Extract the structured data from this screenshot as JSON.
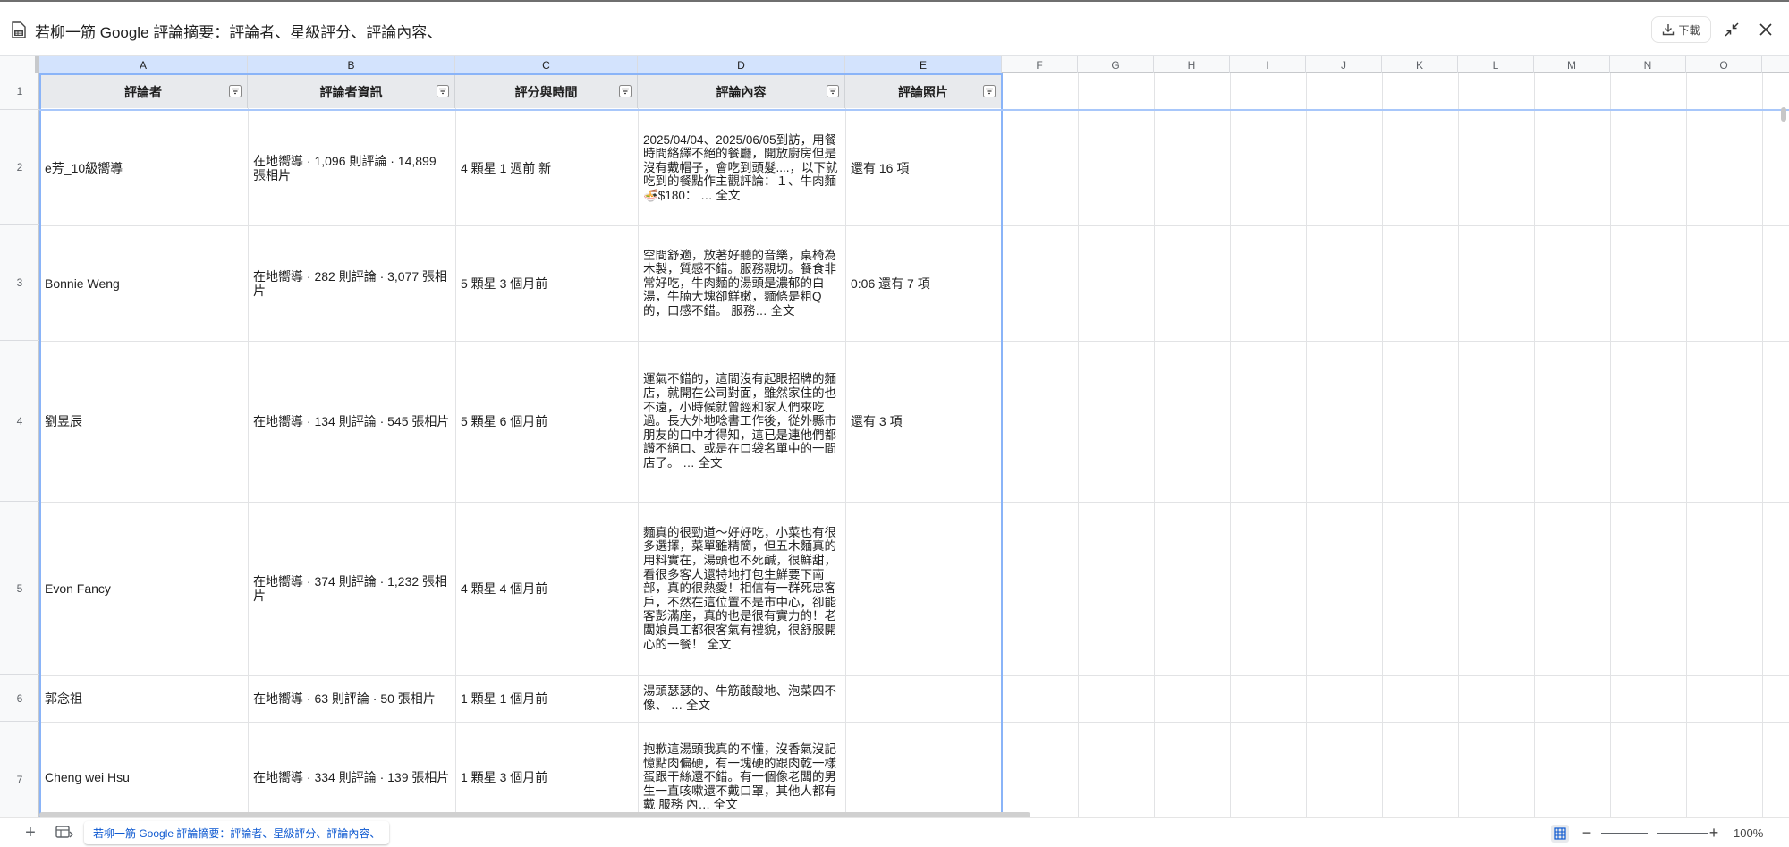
{
  "window": {
    "title": "若柳一筋 Google 評論摘要：評論者、星級評分、評論內容、",
    "download_label": "下載"
  },
  "columns": [
    "A",
    "B",
    "C",
    "D",
    "E",
    "F",
    "G",
    "H",
    "I",
    "J",
    "K",
    "L",
    "M",
    "N",
    "O"
  ],
  "selected_columns": [
    "A",
    "B",
    "C",
    "D",
    "E"
  ],
  "header_row": {
    "row_number": "1",
    "cells": [
      "評論者",
      "評論者資訊",
      "評分與時間",
      "評論內容",
      "評論照片"
    ]
  },
  "rows": [
    {
      "row_number": "2",
      "reviewer": "e芳_10級嚮導",
      "info": "在地嚮導 · 1,096 則評論 · 14,899 張相片",
      "rating": "4 顆星 1 週前 新",
      "content": "2025/04/04、2025/06/05到訪，用餐時間絡繹不絕的餐廳，開放廚房但是沒有戴帽子，會吃到頭髮....，以下就吃到的餐點作主觀評論：１、牛肉麵🍜$180： … 全文",
      "photos": "還有 16 項"
    },
    {
      "row_number": "3",
      "reviewer": "Bonnie Weng",
      "info": "在地嚮導 · 282 則評論 · 3,077 張相片",
      "rating": "5 顆星 3 個月前",
      "content": "空間舒適，放著好聽的音樂，桌椅為木製，質感不錯。服務親切。餐食非常好吃，牛肉麵的湯頭是濃郁的白湯，牛腩大塊卻鮮嫩，麵條是粗Q的，口感不錯。 服務… 全文",
      "photos": "0:06 還有 7 項"
    },
    {
      "row_number": "4",
      "reviewer": "劉昱辰",
      "info": "在地嚮導 · 134 則評論 · 545 張相片",
      "rating": "5 顆星 6 個月前",
      "content": "運氣不錯的，這間沒有起眼招牌的麵店，就開在公司對面，雖然家住的也不遠，小時候就曾經和家人們來吃過。長大外地唸書工作後，從外縣市朋友的口中才得知，這已是連他們都讚不絕口、或是在口袋名單中的一間店了。 … 全文",
      "photos": "還有 3 項"
    },
    {
      "row_number": "5",
      "reviewer": "Evon Fancy",
      "info": "在地嚮導 · 374 則評論 · 1,232 張相片",
      "rating": "4 顆星 4 個月前",
      "content": "麵真的很勁道～好好吃，小菜也有很多選擇，菜單雖精簡，但五木麵真的用料實在，湯頭也不死鹹，很鮮甜，看很多客人還特地打包生鮮要下南部，真的很熱愛！相信有一群死忠客戶，不然在這位置不是市中心，卻能客彭滿座，真的也是很有實力的！老闆娘員工都很客氣有禮貌，很舒服開心的一餐！ 全文",
      "photos": ""
    },
    {
      "row_number": "6",
      "reviewer": "郭念祖",
      "info": "在地嚮導 · 63 則評論 · 50 張相片",
      "rating": "1 顆星 1 個月前",
      "content": "湯頭瑟瑟的、牛筋酸酸地、泡菜四不像、 … 全文",
      "photos": ""
    },
    {
      "row_number": "7",
      "reviewer": "Cheng wei Hsu",
      "info": "在地嚮導 · 334 則評論 · 139 張相片",
      "rating": "1 顆星 3 個月前",
      "content": "抱歉這湯頭我真的不懂，沒香氣沒記憶點肉偏硬，有一塊硬的跟肉乾一樣蛋跟干絲還不錯。有一個像老闆的男生一直咳嗽還不戴口罩，其他人都有戴 服務 內… 全文",
      "photos": ""
    }
  ],
  "bottom_bar": {
    "add_sheet_label": "+",
    "sheet_tab": "若柳一筋 Google 評論摘要：評論者、星級評分、評論內容、",
    "zoom_out": "−",
    "zoom_in": "+",
    "zoom_level": "100%"
  },
  "colors": {
    "selection": "#8ab4f8",
    "selected_header": "#d3e3fd",
    "header_fill": "#e8eaed",
    "tab_text": "#0b57d0"
  },
  "icons": [
    "file-icon",
    "download-icon",
    "collapse-icon",
    "close-icon",
    "filter-icon",
    "sheets-list-icon",
    "grid-icon"
  ]
}
